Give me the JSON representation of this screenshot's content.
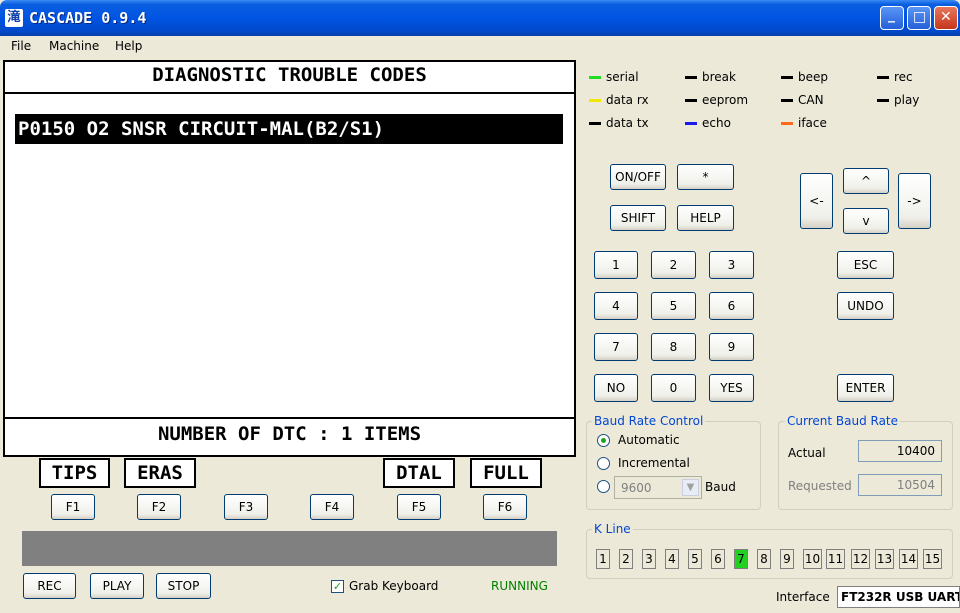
{
  "window": {
    "app_icon_glyph": "滝",
    "title": "CASCADE 0.9.4",
    "min_glyph": "_",
    "max_glyph": "□",
    "close_glyph": "✕"
  },
  "menu": [
    "File",
    "Machine",
    "Help"
  ],
  "display": {
    "title": "DIAGNOSTIC TROUBLE CODES",
    "dtc_items": [
      "P0150 O2 SNSR CIRCUIT-MAL(B2/S1)"
    ],
    "footer": "NUMBER OF DTC  :  1 ITEMS",
    "softkeys": [
      "TIPS",
      "ERAS",
      "",
      "",
      "DTAL",
      "FULL"
    ]
  },
  "function_keys": [
    "F1",
    "F2",
    "F3",
    "F4",
    "F5",
    "F6"
  ],
  "bottom": {
    "rec": "REC",
    "play": "PLAY",
    "stop": "STOP",
    "grab_keyboard": "Grab Keyboard",
    "grab_checked_glyph": "✓",
    "status": "RUNNING"
  },
  "indicators": [
    {
      "label": "serial",
      "color": "#22dd22"
    },
    {
      "label": "break",
      "color": "#000000"
    },
    {
      "label": "beep",
      "color": "#000000"
    },
    {
      "label": "rec",
      "color": "#000000"
    },
    {
      "label": "data rx",
      "color": "#f0e800"
    },
    {
      "label": "eeprom",
      "color": "#000000"
    },
    {
      "label": "CAN",
      "color": "#000000"
    },
    {
      "label": "play",
      "color": "#000000"
    },
    {
      "label": "data tx",
      "color": "#000000"
    },
    {
      "label": "echo",
      "color": "#1a1aee"
    },
    {
      "label": "iface",
      "color": "#ff6a1a"
    }
  ],
  "keypad": {
    "onoff": "ON/OFF",
    "star": "*",
    "shift": "SHIFT",
    "help": "HELP",
    "up": "^",
    "down": "v",
    "left": "<-",
    "right": "->",
    "n1": "1",
    "n2": "2",
    "n3": "3",
    "n4": "4",
    "n5": "5",
    "n6": "6",
    "n7": "7",
    "n8": "8",
    "n9": "9",
    "no": "NO",
    "n0": "0",
    "yes": "YES",
    "esc": "ESC",
    "undo": "UNDO",
    "enter": "ENTER"
  },
  "baud_control": {
    "title": "Baud Rate Control",
    "automatic": "Automatic",
    "incremental": "Incremental",
    "fixed_value": "9600",
    "baud": "Baud",
    "selected": "Automatic"
  },
  "current_baud": {
    "title": "Current Baud Rate",
    "actual_label": "Actual",
    "actual_value": "10400",
    "requested_label": "Requested",
    "requested_value": "10504"
  },
  "kline": {
    "title": "K Line",
    "lines": [
      "1",
      "2",
      "3",
      "4",
      "5",
      "6",
      "7",
      "8",
      "9",
      "10",
      "11",
      "12",
      "13",
      "14",
      "15"
    ],
    "active": "7",
    "active_color": "#22d022"
  },
  "interface": {
    "label": "Interface",
    "value": "FT232R USB UART"
  }
}
